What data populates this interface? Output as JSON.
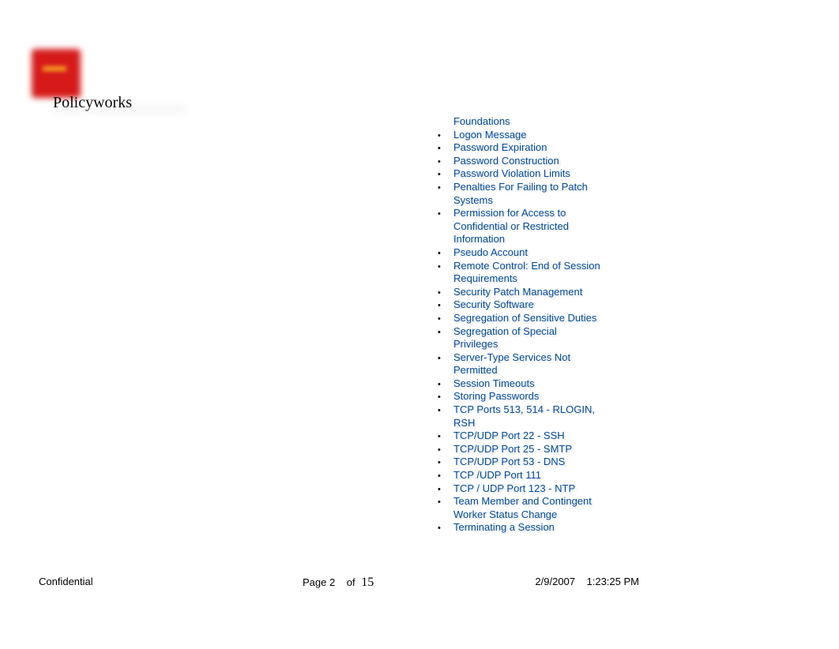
{
  "header": {
    "title": "Policyworks"
  },
  "list": {
    "items": [
      {
        "label": "Foundations",
        "cont": true
      },
      {
        "label": "Logon Message"
      },
      {
        "label": "Password Expiration"
      },
      {
        "label": "Password Construction"
      },
      {
        "label": "Password Violation Limits"
      },
      {
        "label": "Penalties For Failing to Patch Systems"
      },
      {
        "label": "Permission for Access to Confidential or Restricted Information"
      },
      {
        "label": "Pseudo Account"
      },
      {
        "label": "Remote Control: End of Session Requirements"
      },
      {
        "label": "Security Patch Management"
      },
      {
        "label": "Security Software"
      },
      {
        "label": "Segregation of Sensitive Duties"
      },
      {
        "label": "Segregation of Special Privileges"
      },
      {
        "label": "Server-Type Services Not Permitted"
      },
      {
        "label": "Session Timeouts"
      },
      {
        "label": "Storing Passwords"
      },
      {
        "label": "TCP Ports 513, 514 - RLOGIN, RSH"
      },
      {
        "label": "TCP/UDP Port 22 - SSH"
      },
      {
        "label": "TCP/UDP Port 25 - SMTP"
      },
      {
        "label": "TCP/UDP Port 53 - DNS"
      },
      {
        "label": "TCP /UDP Port 111"
      },
      {
        "label": "TCP / UDP Port 123 - NTP"
      },
      {
        "label": "Team Member and Contingent Worker Status Change"
      },
      {
        "label": "Terminating a Session"
      }
    ]
  },
  "footer": {
    "confidential": "Confidential",
    "page_label": "Page",
    "page_current": "2",
    "page_of": "of",
    "page_total": "15",
    "date": "2/9/2007",
    "time": "1:23:25 PM"
  }
}
